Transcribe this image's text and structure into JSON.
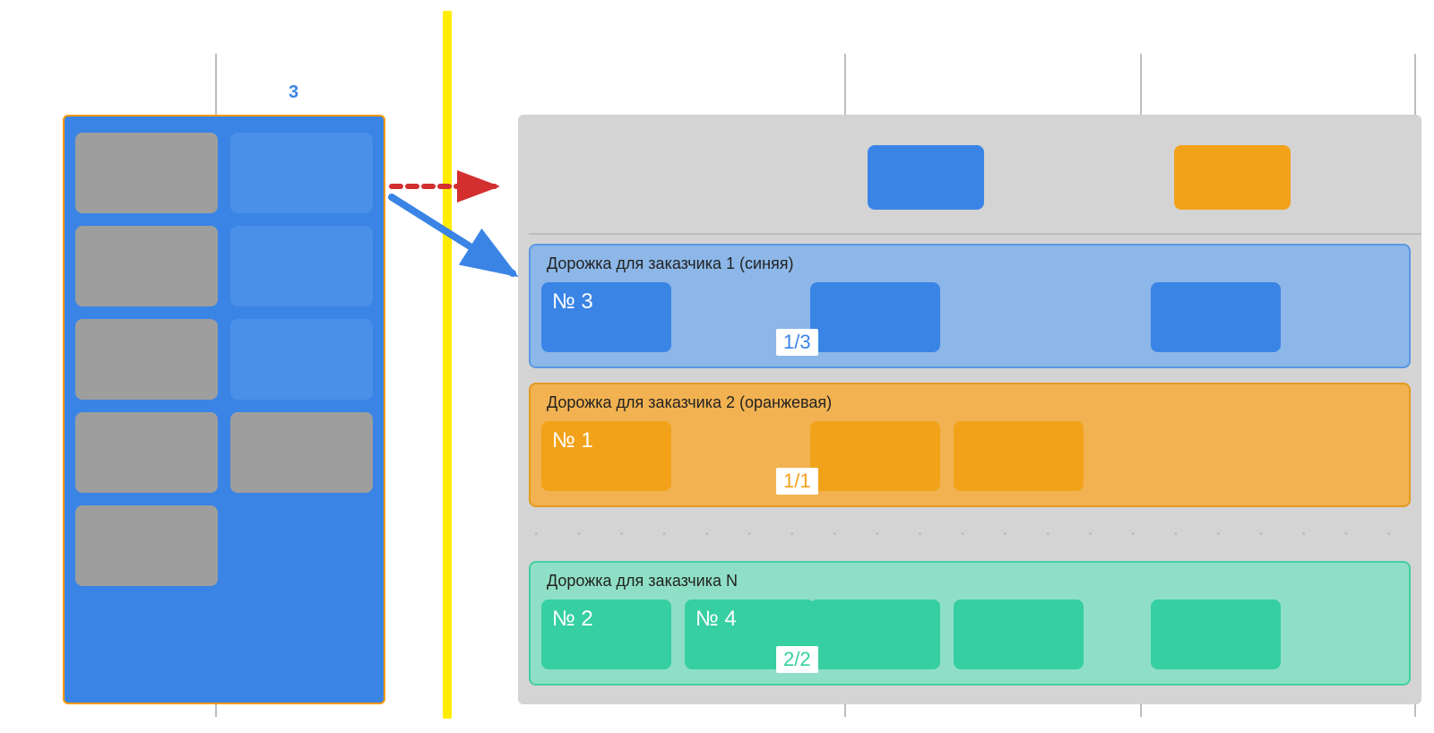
{
  "left": {
    "label_col1": "",
    "label_col2": "3",
    "cards": [
      {
        "type": "grey"
      },
      {
        "type": "blue"
      },
      {
        "type": "grey"
      },
      {
        "type": "blue"
      },
      {
        "type": "grey"
      },
      {
        "type": "blue"
      },
      {
        "type": "grey"
      },
      {
        "type": "grey"
      },
      {
        "type": "grey"
      }
    ]
  },
  "right_header": {
    "blue_card": "",
    "orange_card": ""
  },
  "lanes": [
    {
      "color": "blue",
      "title": "Дорожка для заказчика 1 (синяя)",
      "ratio": "1/3",
      "tasks": [
        {
          "label": "№ 3",
          "pos": 0
        },
        {
          "label": "",
          "pos": 300
        },
        {
          "label": "",
          "pos": 680
        }
      ]
    },
    {
      "color": "orange",
      "title": "Дорожка для заказчика 2 (оранжевая)",
      "ratio": "1/1",
      "tasks": [
        {
          "label": "№ 1",
          "pos": 0
        },
        {
          "label": "",
          "pos": 300
        },
        {
          "label": "",
          "pos": 460
        }
      ]
    },
    {
      "color": "teal",
      "title": "Дорожка для заказчика N",
      "ratio": "2/2",
      "tasks": [
        {
          "label": "№ 2",
          "pos": 0
        },
        {
          "label": "№ 4",
          "pos": 160
        },
        {
          "label": "",
          "pos": 300
        },
        {
          "label": "",
          "pos": 460
        },
        {
          "label": "",
          "pos": 680
        }
      ]
    }
  ],
  "ellipsis": ". . . . . . . . . . . . . . . . . . . . . .",
  "top_right_label": ""
}
